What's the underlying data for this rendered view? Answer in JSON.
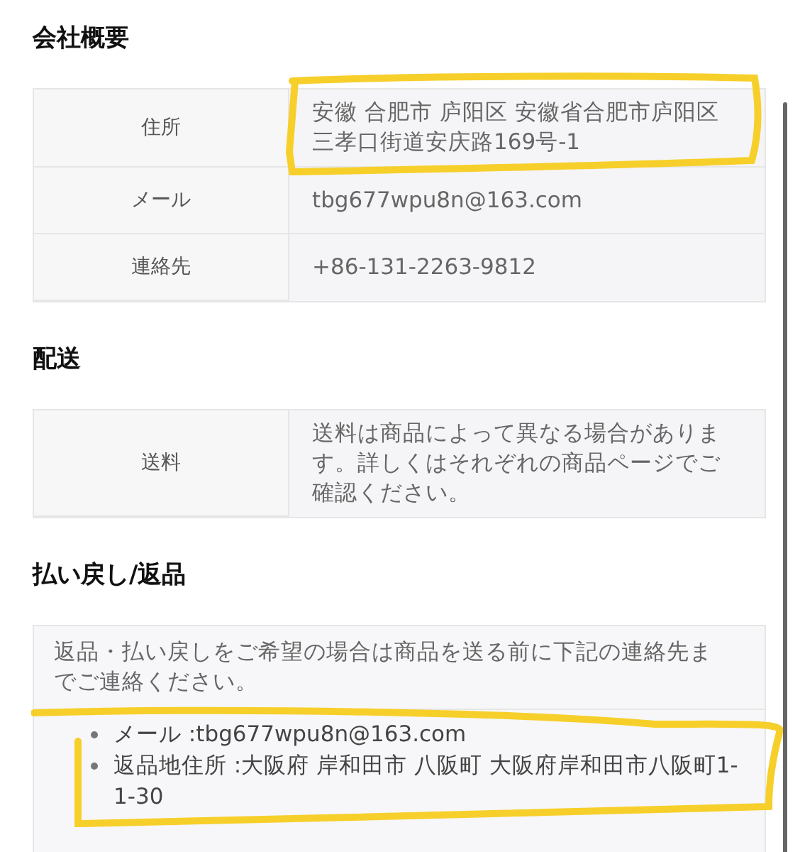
{
  "sections": [
    {
      "title": "会社概要",
      "kind": "table",
      "rows": [
        {
          "label": "住所",
          "value": "安徽 合肥市 庐阳区 安徽省合肥市庐阳区三孝口街道安庆路169号-1",
          "highlighted": true
        },
        {
          "label": "メール",
          "value": "tbg677wpu8n@163.com"
        },
        {
          "label": "連絡先",
          "value": "+86-131-2263-9812"
        }
      ]
    },
    {
      "title": "配送",
      "kind": "table",
      "rows": [
        {
          "label": "送料",
          "value": "送料は商品によって異なる場合があります。詳しくはそれぞれの商品ページでご確認ください。"
        }
      ]
    },
    {
      "title": "払い戻し/返品",
      "kind": "notice",
      "note": "返品・払い戻しをご希望の場合は商品を送る前に下記の連絡先までご連絡ください。",
      "highlighted": true,
      "items": [
        "メール :tbg677wpu8n@163.com",
        "返品地住所 :大阪府 岸和田市 八阪町 大阪府岸和田市八阪町1-1-30"
      ]
    }
  ]
}
